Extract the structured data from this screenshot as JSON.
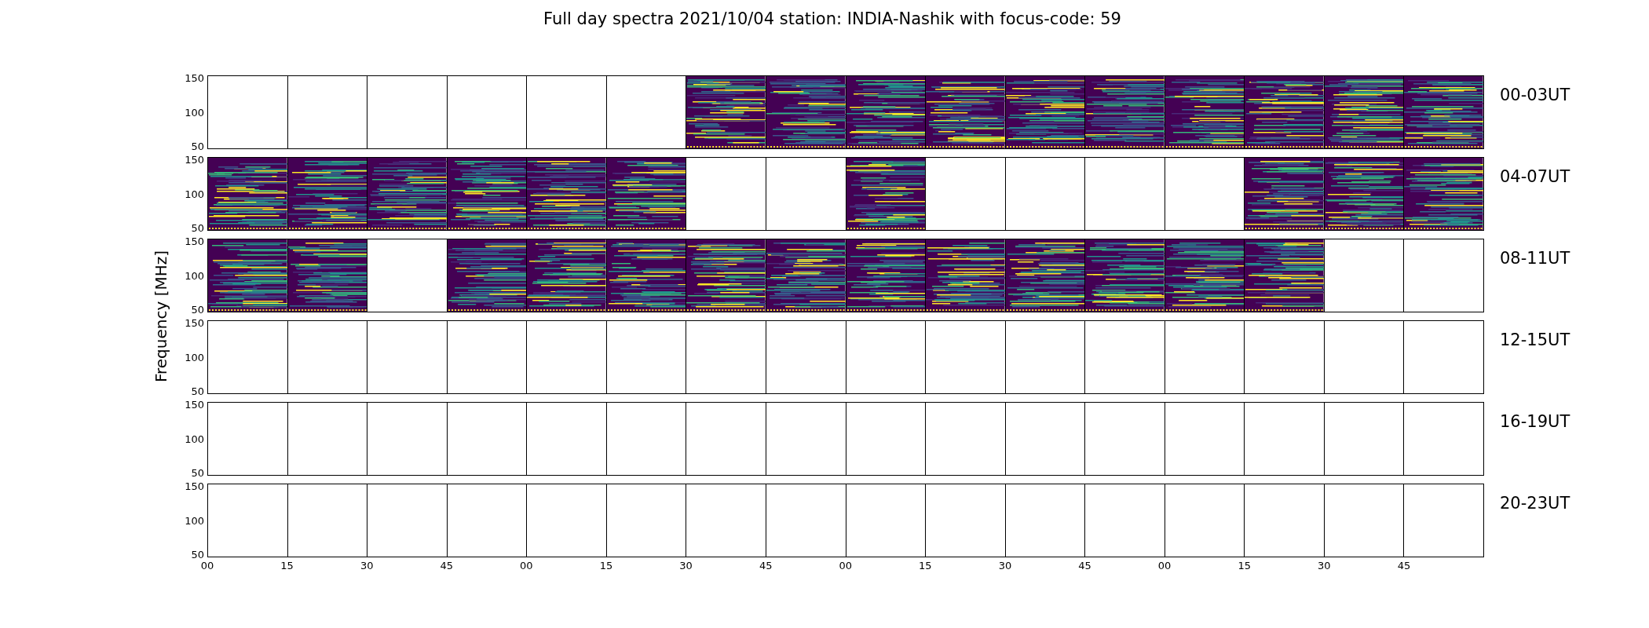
{
  "title": "Full day spectra 2021/10/04 station: INDIA-Nashik with focus-code: 59",
  "ylabel": "Frequency [MHz]",
  "rows": [
    {
      "label": "00-03UT",
      "y_tick_labels": [
        "150",
        "100",
        "50"
      ],
      "panels": [
        {
          "kind": "blank"
        },
        {
          "kind": "blank"
        },
        {
          "kind": "blank"
        },
        {
          "kind": "blank"
        },
        {
          "kind": "blank"
        },
        {
          "kind": "blank"
        },
        {
          "kind": "spectrum"
        },
        {
          "kind": "spectrum"
        },
        {
          "kind": "spectrum"
        },
        {
          "kind": "spectrum"
        },
        {
          "kind": "spectrum"
        },
        {
          "kind": "spectrum"
        },
        {
          "kind": "spectrum"
        },
        {
          "kind": "spectrum"
        },
        {
          "kind": "spectrum"
        },
        {
          "kind": "spectrum"
        }
      ]
    },
    {
      "label": "04-07UT",
      "y_tick_labels": [
        "150",
        "100",
        "50"
      ],
      "panels": [
        {
          "kind": "spectrum"
        },
        {
          "kind": "spectrum"
        },
        {
          "kind": "spectrum"
        },
        {
          "kind": "spectrum"
        },
        {
          "kind": "spectrum"
        },
        {
          "kind": "spectrum"
        },
        {
          "kind": "blank"
        },
        {
          "kind": "blank"
        },
        {
          "kind": "spectrum"
        },
        {
          "kind": "blank"
        },
        {
          "kind": "blank"
        },
        {
          "kind": "blank"
        },
        {
          "kind": "blank"
        },
        {
          "kind": "spectrum"
        },
        {
          "kind": "spectrum"
        },
        {
          "kind": "spectrum"
        }
      ]
    },
    {
      "label": "08-11UT",
      "y_tick_labels": [
        "150",
        "100",
        "50"
      ],
      "panels": [
        {
          "kind": "spectrum"
        },
        {
          "kind": "spectrum"
        },
        {
          "kind": "blank"
        },
        {
          "kind": "spectrum"
        },
        {
          "kind": "spectrum"
        },
        {
          "kind": "spectrum"
        },
        {
          "kind": "spectrum"
        },
        {
          "kind": "spectrum"
        },
        {
          "kind": "spectrum"
        },
        {
          "kind": "spectrum"
        },
        {
          "kind": "spectrum"
        },
        {
          "kind": "spectrum"
        },
        {
          "kind": "spectrum"
        },
        {
          "kind": "spectrum"
        },
        {
          "kind": "blank"
        },
        {
          "kind": "blank"
        }
      ]
    },
    {
      "label": "12-15UT",
      "y_tick_labels": [
        "150",
        "100",
        "50"
      ],
      "panels": [
        {
          "kind": "blank"
        },
        {
          "kind": "blank"
        },
        {
          "kind": "blank"
        },
        {
          "kind": "blank"
        },
        {
          "kind": "blank"
        },
        {
          "kind": "blank"
        },
        {
          "kind": "blank"
        },
        {
          "kind": "blank"
        },
        {
          "kind": "blank"
        },
        {
          "kind": "blank"
        },
        {
          "kind": "blank"
        },
        {
          "kind": "blank"
        },
        {
          "kind": "blank"
        },
        {
          "kind": "blank"
        },
        {
          "kind": "blank"
        },
        {
          "kind": "blank"
        }
      ]
    },
    {
      "label": "16-19UT",
      "y_tick_labels": [
        "150",
        "100",
        "50"
      ],
      "panels": [
        {
          "kind": "blank"
        },
        {
          "kind": "blank"
        },
        {
          "kind": "blank"
        },
        {
          "kind": "blank"
        },
        {
          "kind": "blank"
        },
        {
          "kind": "blank"
        },
        {
          "kind": "blank"
        },
        {
          "kind": "blank"
        },
        {
          "kind": "blank"
        },
        {
          "kind": "blank"
        },
        {
          "kind": "blank"
        },
        {
          "kind": "blank"
        },
        {
          "kind": "blank"
        },
        {
          "kind": "blank"
        },
        {
          "kind": "blank"
        },
        {
          "kind": "blank"
        }
      ]
    },
    {
      "label": "20-23UT",
      "y_tick_labels": [
        "150",
        "100",
        "50"
      ],
      "panels": [
        {
          "kind": "blank"
        },
        {
          "kind": "blank"
        },
        {
          "kind": "blank"
        },
        {
          "kind": "blank"
        },
        {
          "kind": "blank"
        },
        {
          "kind": "blank"
        },
        {
          "kind": "blank"
        },
        {
          "kind": "blank"
        },
        {
          "kind": "blank"
        },
        {
          "kind": "blank"
        },
        {
          "kind": "blank"
        },
        {
          "kind": "blank"
        },
        {
          "kind": "blank"
        },
        {
          "kind": "blank"
        },
        {
          "kind": "blank"
        },
        {
          "kind": "blank"
        }
      ]
    }
  ],
  "x_tick_labels": [
    "00",
    "15",
    "30",
    "45",
    "00",
    "15",
    "30",
    "45",
    "00",
    "15",
    "30",
    "45",
    "00",
    "15",
    "30",
    "45"
  ]
}
